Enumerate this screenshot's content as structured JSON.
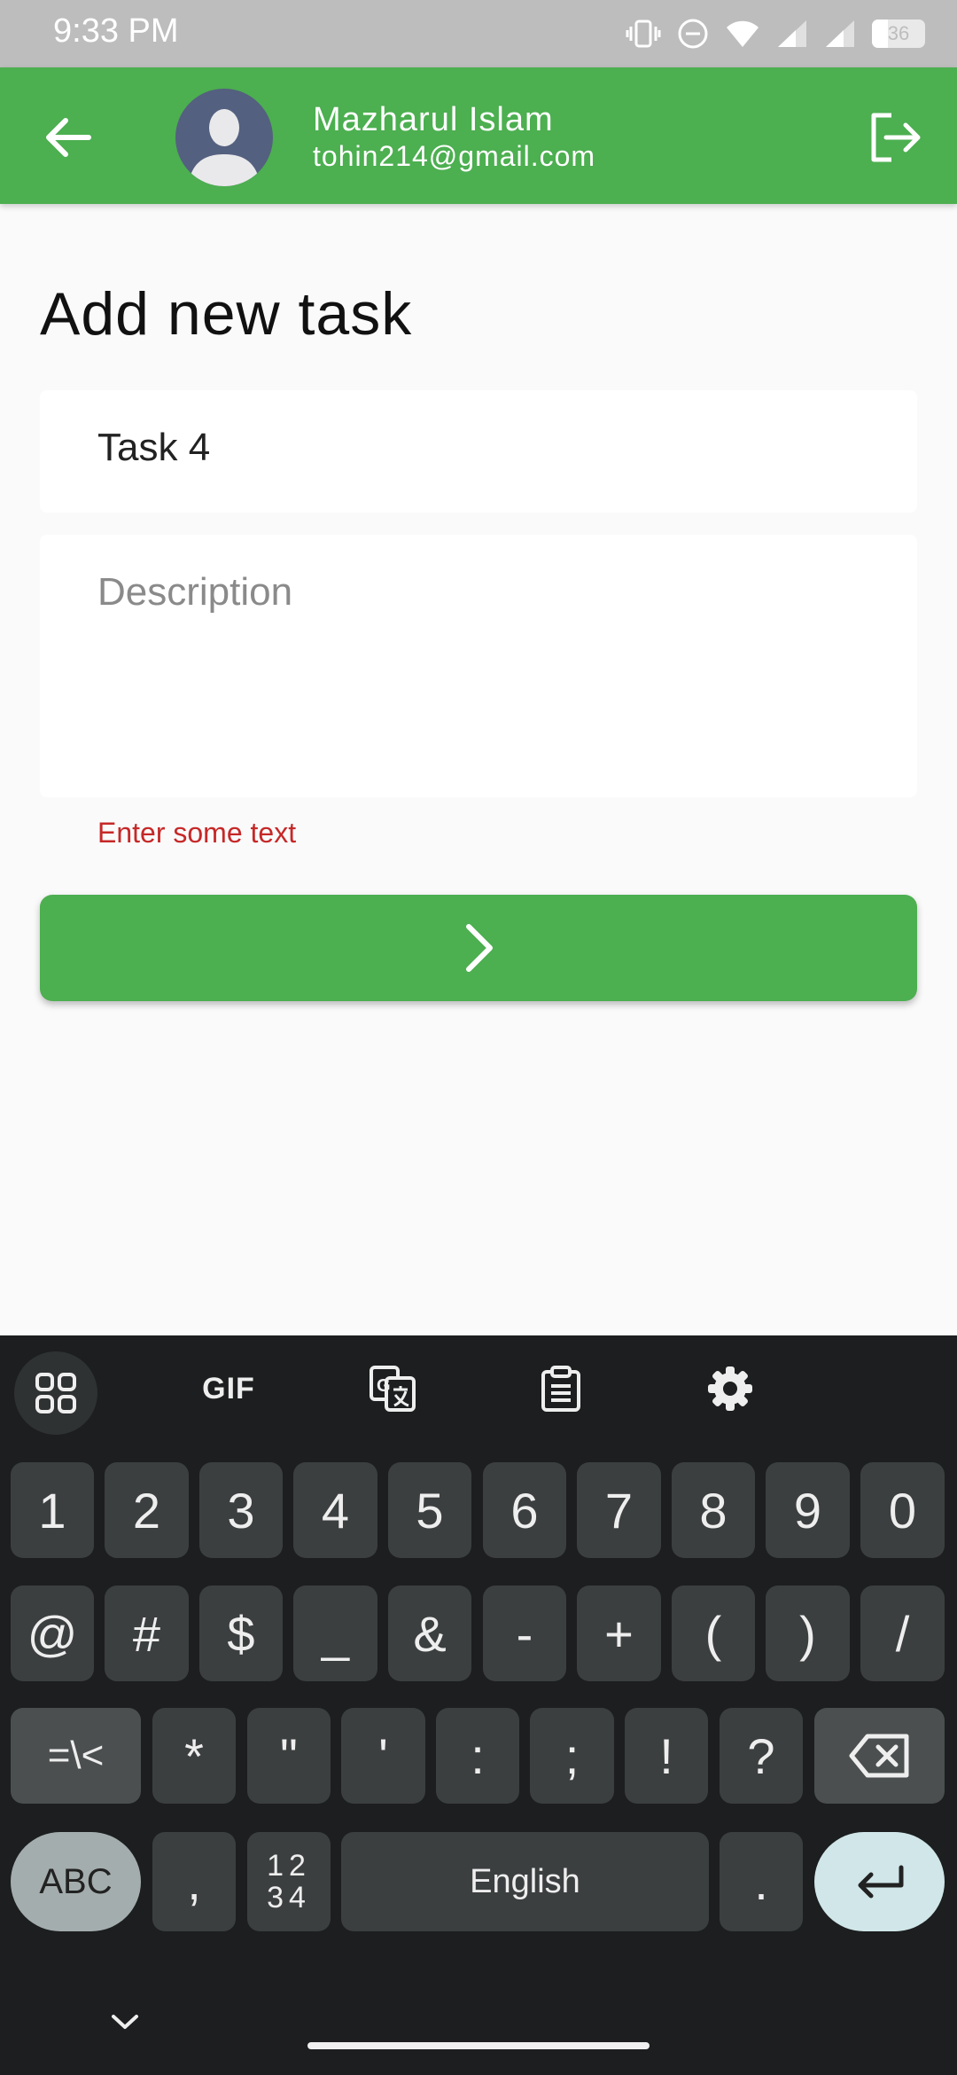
{
  "status_bar": {
    "time": "9:33 PM",
    "battery_level": "36",
    "icons": [
      "vibrate-icon",
      "dnd-icon",
      "wifi-icon",
      "signal-icon",
      "signal-icon-2",
      "battery-icon"
    ]
  },
  "app_bar": {
    "user_name": "Mazharul Islam",
    "user_email": "tohin214@gmail.com",
    "icons": [
      "back-arrow-icon",
      "avatar",
      "logout-icon"
    ]
  },
  "form": {
    "title": "Add new task",
    "title_field_value": "Task 4",
    "description_placeholder": "Description",
    "error_text": "Enter some text",
    "submit_icon": "chevron-right-icon"
  },
  "keyboard": {
    "toolbar": {
      "gif_label": "GIF",
      "icons": [
        "apps-grid-icon",
        "gif-icon",
        "translate-icon",
        "clipboard-icon",
        "settings-gear-icon"
      ]
    },
    "row1": [
      "1",
      "2",
      "3",
      "4",
      "5",
      "6",
      "7",
      "8",
      "9",
      "0"
    ],
    "row2": [
      "@",
      "#",
      "$",
      "_",
      "&",
      "-",
      "+",
      "(",
      ")",
      "/"
    ],
    "row3": [
      "=\\<",
      "*",
      "\"",
      "'",
      ":",
      ";",
      "!",
      "?"
    ],
    "abc_label": "ABC",
    "comma_label": ",",
    "numpad_top": "12",
    "numpad_bottom": "34",
    "space_label": "English",
    "period_label": ".",
    "colors": {
      "background": "#1c1e1f",
      "key": "#3c3f40",
      "enter": "#d0e6e8"
    }
  },
  "theme": {
    "primary": "#4caf50",
    "error": "#c62828"
  }
}
